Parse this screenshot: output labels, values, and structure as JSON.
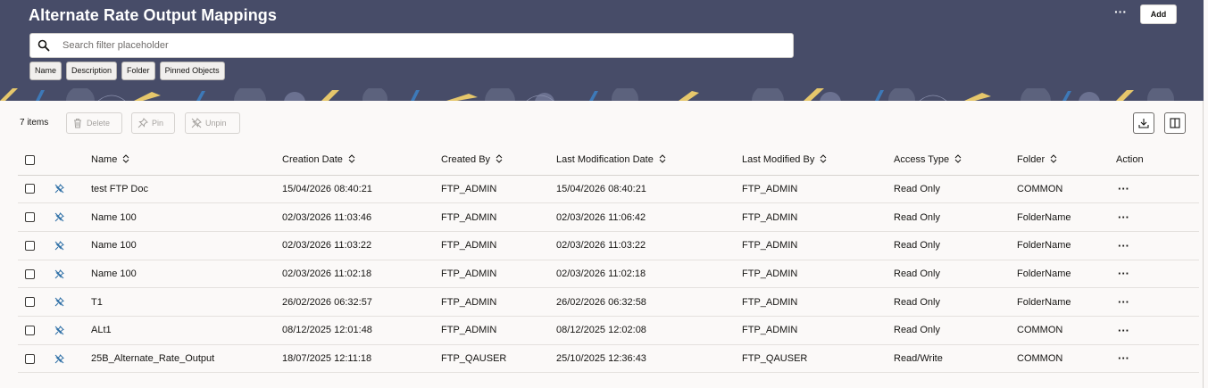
{
  "page": {
    "title": "Alternate Rate Output Mappings",
    "add_label": "Add",
    "more_label": "···"
  },
  "search": {
    "placeholder": "Search filter placeholder",
    "value": ""
  },
  "filter_chips": [
    "Name",
    "Description",
    "Folder",
    "Pinned Objects"
  ],
  "toolbar": {
    "items_count": "7 items",
    "delete_label": "Delete",
    "pin_label": "Pin",
    "unpin_label": "Unpin"
  },
  "table": {
    "columns": [
      "Name",
      "Creation Date",
      "Created By",
      "Last Modification Date",
      "Last Modified By",
      "Access Type",
      "Folder",
      "Action"
    ],
    "rows": [
      {
        "name": "test FTP Doc",
        "creation_date": "15/04/2026 08:40:21",
        "created_by": "FTP_ADMIN",
        "last_mod_date": "15/04/2026 08:40:21",
        "last_mod_by": "FTP_ADMIN",
        "access_type": "Read Only",
        "folder": "COMMON",
        "action": "···"
      },
      {
        "name": "Name 100",
        "creation_date": "02/03/2026 11:03:46",
        "created_by": "FTP_ADMIN",
        "last_mod_date": "02/03/2026 11:06:42",
        "last_mod_by": "FTP_ADMIN",
        "access_type": "Read Only",
        "folder": "FolderName",
        "action": "···"
      },
      {
        "name": "Name 100",
        "creation_date": "02/03/2026 11:03:22",
        "created_by": "FTP_ADMIN",
        "last_mod_date": "02/03/2026 11:03:22",
        "last_mod_by": "FTP_ADMIN",
        "access_type": "Read Only",
        "folder": "FolderName",
        "action": "···"
      },
      {
        "name": "Name 100",
        "creation_date": "02/03/2026 11:02:18",
        "created_by": "FTP_ADMIN",
        "last_mod_date": "02/03/2026 11:02:18",
        "last_mod_by": "FTP_ADMIN",
        "access_type": "Read Only",
        "folder": "FolderName",
        "action": "···"
      },
      {
        "name": "T1",
        "creation_date": "26/02/2026 06:32:57",
        "created_by": "FTP_ADMIN",
        "last_mod_date": "26/02/2026 06:32:58",
        "last_mod_by": "FTP_ADMIN",
        "access_type": "Read Only",
        "folder": "FolderName",
        "action": "···"
      },
      {
        "name": "ALt1",
        "creation_date": "08/12/2025 12:01:48",
        "created_by": "FTP_ADMIN",
        "last_mod_date": "08/12/2025 12:02:08",
        "last_mod_by": "FTP_ADMIN",
        "access_type": "Read Only",
        "folder": "COMMON",
        "action": "···"
      },
      {
        "name": "25B_Alternate_Rate_Output",
        "creation_date": "18/07/2025 12:11:18",
        "created_by": "FTP_QAUSER",
        "last_mod_date": "25/10/2025 12:36:43",
        "last_mod_by": "FTP_QAUSER",
        "access_type": "Read/Write",
        "folder": "COMMON",
        "action": "···"
      }
    ]
  },
  "colors": {
    "header_bg": "#474c68",
    "page_bg": "#fbf9f8",
    "pattern_accent": "#e6c76b",
    "pin_blue": "#2d6fa6"
  },
  "icons": {
    "search": "search-icon",
    "delete": "trash-icon",
    "pin": "pin-icon",
    "unpin": "unpin-icon",
    "download": "download-icon",
    "columns": "columns-icon",
    "sort": "sort-icon",
    "row_pin": "unpinned-icon"
  }
}
